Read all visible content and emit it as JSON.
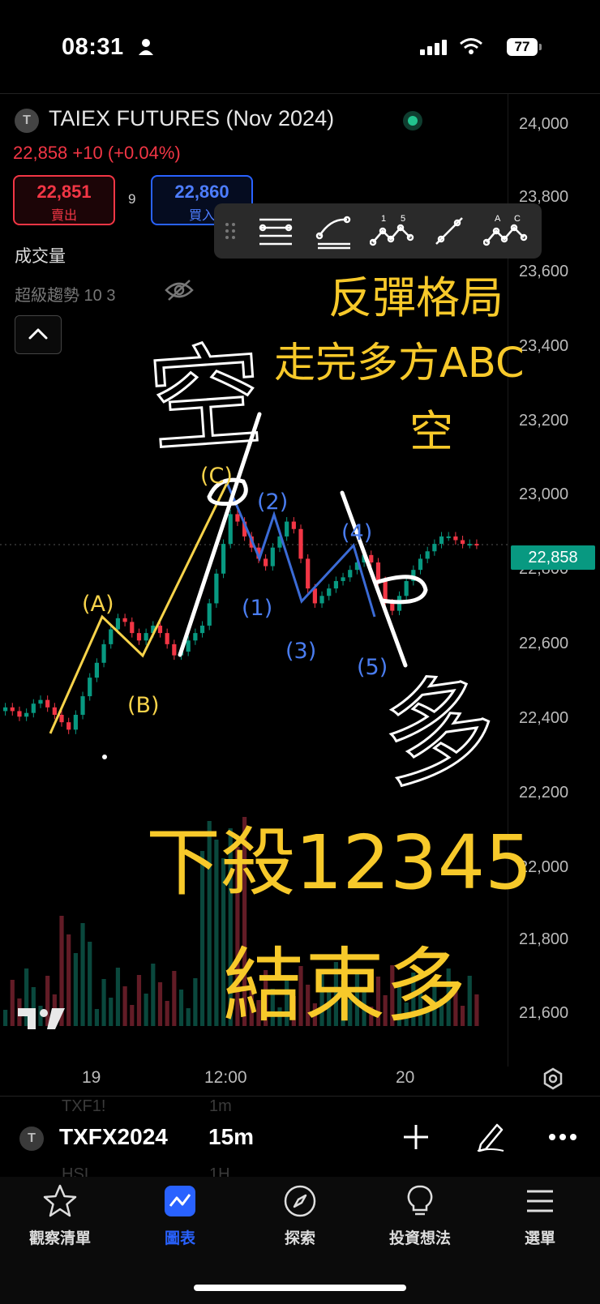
{
  "status_bar": {
    "time": "08:31",
    "battery": "77"
  },
  "header": {
    "ticker_logo": "T",
    "ticker_name": "TAIEX FUTURES (Nov 2024)",
    "price_line": "22,858 +10 (+0.04%)",
    "sell": {
      "price": "22,851",
      "label": "賣出"
    },
    "buy": {
      "price": "22,860",
      "label": "買入"
    },
    "spread": "9",
    "volume_label": "成交量",
    "indicator_label": "超級趨勢 10 3"
  },
  "drawing_toolbar": {
    "tools": [
      "grip-icon",
      "horizontal-lines-tool-icon",
      "curve-tool-icon",
      "wave-15-tool-icon",
      "trendline-tool-icon",
      "wave-abc-tool-icon"
    ],
    "wave15_labels": [
      "1",
      "5"
    ],
    "waveabc_labels": [
      "A",
      "C"
    ]
  },
  "price_axis": [
    "24,000",
    "23,800",
    "23,600",
    "23,400",
    "23,200",
    "23,000",
    "22,800",
    "22,600",
    "22,400",
    "22,200",
    "22,000",
    "21,800",
    "21,600"
  ],
  "current_price": "22,858",
  "time_axis": [
    "19",
    "12:00",
    "20"
  ],
  "annotations": {
    "title1": "反彈格局",
    "title2": "走完多方ABC",
    "title3": "空",
    "bottom1": "下殺12345",
    "bottom2": "結束多",
    "hand_short": "空",
    "hand_long": "多",
    "waves_yellow": [
      "(A)",
      "(B)",
      "(C)"
    ],
    "waves_blue": [
      "(1)",
      "(2)",
      "(3)",
      "(4)",
      "(5)"
    ]
  },
  "tradingview_logo": "TV",
  "bottom_toolbar": {
    "symbol_logo": "T",
    "symbol": "TXFX2024",
    "interval": "15m",
    "ghost_symbols": [
      "TXF1!",
      "HSI"
    ],
    "ghost_intervals": [
      "1m",
      "1H"
    ]
  },
  "tabs": [
    {
      "label": "觀察清單",
      "icon": "star-icon"
    },
    {
      "label": "圖表",
      "icon": "chart-icon",
      "active": true
    },
    {
      "label": "探索",
      "icon": "compass-icon"
    },
    {
      "label": "投資想法",
      "icon": "lightbulb-icon"
    },
    {
      "label": "選單",
      "icon": "menu-icon"
    }
  ],
  "colors": {
    "up": "#089981",
    "down": "#f23645",
    "accent": "#2962ff",
    "annotation": "#f7c92a",
    "wave_blue": "#4a7df0"
  },
  "chart_data": {
    "type": "candlestick",
    "price_range": [
      21500,
      24100
    ],
    "closes": [
      22420,
      22410,
      22395,
      22405,
      22430,
      22440,
      22420,
      22400,
      22380,
      22360,
      22400,
      22450,
      22500,
      22540,
      22590,
      22630,
      22660,
      22650,
      22620,
      22600,
      22620,
      22640,
      22620,
      22590,
      22560,
      22570,
      22600,
      22620,
      22640,
      22700,
      22780,
      22860,
      22940,
      22920,
      22880,
      22850,
      22820,
      22800,
      22850,
      22880,
      22920,
      22900,
      22820,
      22740,
      22700,
      22720,
      22740,
      22760,
      22770,
      22790,
      22810,
      22830,
      22810,
      22760,
      22700,
      22680,
      22720,
      22760,
      22790,
      22820,
      22840,
      22860,
      22880,
      22880,
      22870,
      22860,
      22860,
      22858
    ]
  }
}
